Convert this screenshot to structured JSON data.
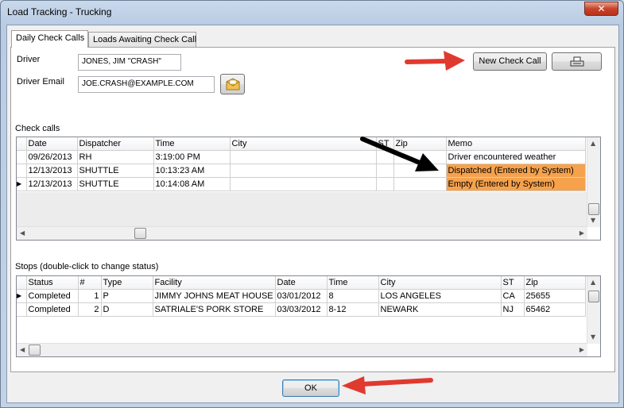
{
  "window": {
    "title": "Load Tracking - Trucking",
    "close_glyph": "✕"
  },
  "tabs": [
    {
      "label": "Daily Check Calls",
      "active": true
    },
    {
      "label": "Loads Awaiting Check Call",
      "active": false
    }
  ],
  "driver": {
    "label": "Driver",
    "value": "JONES, JIM \"CRASH\"",
    "email_label": "Driver Email",
    "email_value": "JOE.CRASH@EXAMPLE.COM"
  },
  "buttons": {
    "new_check_call": "New Check Call",
    "ok": "OK"
  },
  "check_calls": {
    "label": "Check calls",
    "columns": [
      "Date",
      "Dispatcher",
      "Time",
      "City",
      "ST",
      "Zip",
      "Memo"
    ],
    "rows": [
      {
        "date": "09/26/2013",
        "dispatcher": "RH",
        "time": "3:19:00 PM",
        "city": "",
        "st": "",
        "zip": "",
        "memo": "Driver encountered weather",
        "highlight": false,
        "current": false
      },
      {
        "date": "12/13/2013",
        "dispatcher": "SHUTTLE",
        "time": "10:13:23 AM",
        "city": "",
        "st": "",
        "zip": "",
        "memo": "Dispatched (Entered by System)",
        "highlight": true,
        "current": false
      },
      {
        "date": "12/13/2013",
        "dispatcher": "SHUTTLE",
        "time": "10:14:08 AM",
        "city": "",
        "st": "",
        "zip": "",
        "memo": "Empty (Entered by System)",
        "highlight": true,
        "current": true
      }
    ]
  },
  "stops": {
    "label": "Stops (double-click to change status)",
    "columns": [
      "Status",
      "#",
      "Type",
      "Facility",
      "Date",
      "Time",
      "City",
      "ST",
      "Zip"
    ],
    "rows": [
      {
        "status": "Completed",
        "num": "1",
        "type": "P",
        "facility": "JIMMY JOHNS MEAT HOUSE",
        "date": "03/01/2012",
        "time": "8",
        "city": "LOS ANGELES",
        "st": "CA",
        "zip": "25655",
        "current": true
      },
      {
        "status": "Completed",
        "num": "2",
        "type": "D",
        "facility": "SATRIALE'S PORK STORE",
        "date": "03/03/2012",
        "time": "8-12",
        "city": "NEWARK",
        "st": "NJ",
        "zip": "65462",
        "current": false
      }
    ]
  },
  "icons": {
    "email": "envelope-icon",
    "print": "printer-icon",
    "row_pointer": "▶",
    "arrow_up": "▲",
    "arrow_down": "▼",
    "arrow_left": "◀",
    "arrow_right": "▶"
  },
  "colors": {
    "memo_highlight": "#f6a24d",
    "annotation_arrow_red": "#e03a2f",
    "annotation_arrow_black": "#000000"
  }
}
